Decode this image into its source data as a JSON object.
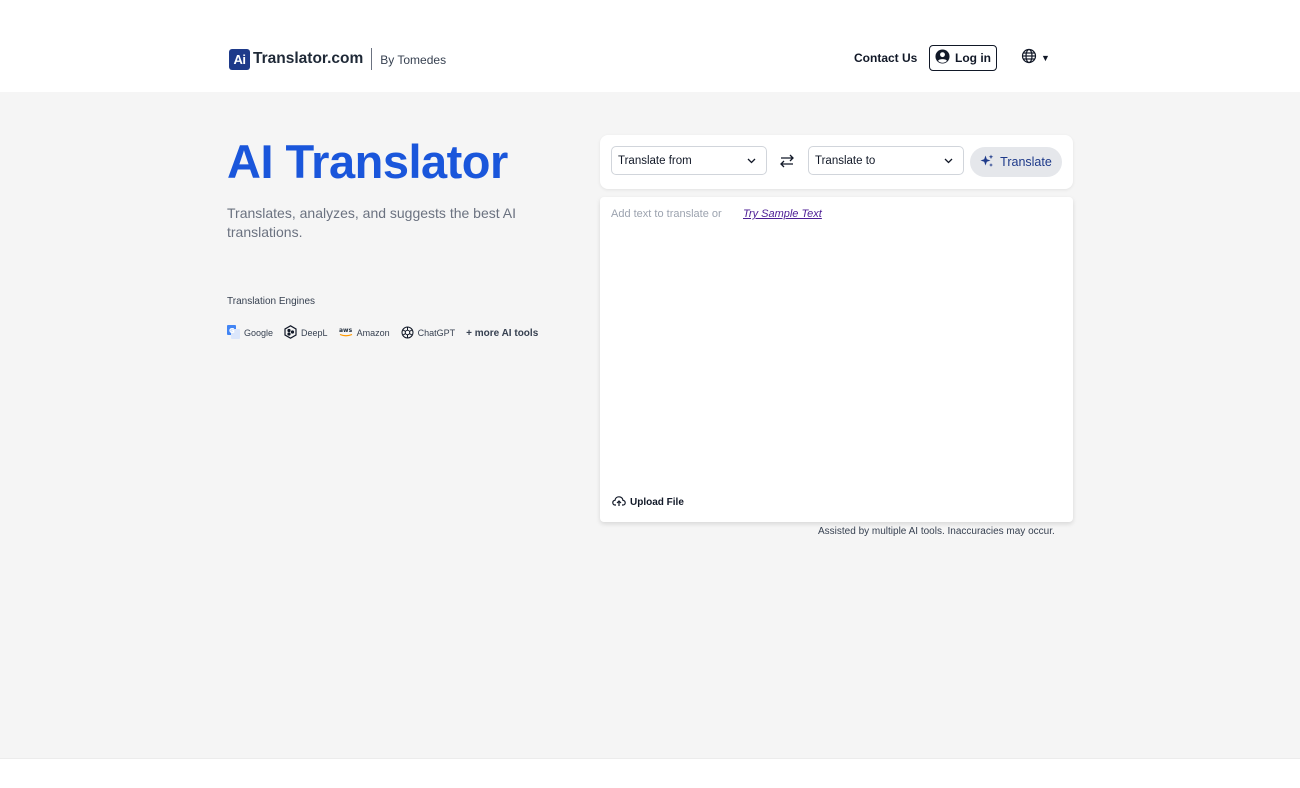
{
  "header": {
    "logo_badge": "Ai",
    "logo_text": "Translator.com",
    "logo_by": "By Tomedes",
    "contact_label": "Contact Us",
    "login_label": "Log in",
    "lang_icon": "globe-icon"
  },
  "hero": {
    "title": "AI Translator",
    "subtitle": "Translates, analyzes, and suggests the best AI translations.",
    "engines_label": "Translation Engines",
    "engines": [
      {
        "name": "Google",
        "icon": "google-translate-icon"
      },
      {
        "name": "DeepL",
        "icon": "deepl-icon"
      },
      {
        "name": "Amazon",
        "icon": "aws-icon"
      },
      {
        "name": "ChatGPT",
        "icon": "chatgpt-icon"
      }
    ],
    "more_tools": "+ more AI tools"
  },
  "translator": {
    "from_placeholder": "Translate from",
    "to_placeholder": "Translate to",
    "translate_button": "Translate",
    "input_placeholder": "Add text to translate or",
    "sample_link": "Try Sample Text",
    "upload_label": "Upload File",
    "disclaimer": "Assisted by multiple AI tools. Inaccuracies may occur."
  },
  "colors": {
    "brand_blue": "#1a56db",
    "logo_navy": "#1e3a8a",
    "background": "#f5f5f5"
  }
}
